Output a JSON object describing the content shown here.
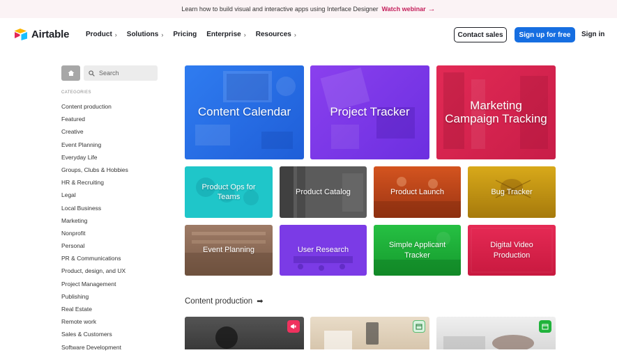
{
  "banner": {
    "text": "Learn how to build visual and interactive apps using Interface Designer",
    "link": "Watch webinar"
  },
  "nav": {
    "logo": "Airtable",
    "menu": [
      {
        "label": "Product",
        "chevron": true
      },
      {
        "label": "Solutions",
        "chevron": true
      },
      {
        "label": "Pricing",
        "chevron": false
      },
      {
        "label": "Enterprise",
        "chevron": true
      },
      {
        "label": "Resources",
        "chevron": true
      }
    ],
    "contact_sales": "Contact sales",
    "sign_up": "Sign up for free",
    "sign_in": "Sign in"
  },
  "sidebar": {
    "search_placeholder": "Search",
    "categories_title": "CATEGORIES",
    "categories": [
      "Content production",
      "Featured",
      "Creative",
      "Event Planning",
      "Everyday Life",
      "Groups, Clubs & Hobbies",
      "HR & Recruiting",
      "Legal",
      "Local Business",
      "Marketing",
      "Nonprofit",
      "Personal",
      "PR & Communications",
      "Product, design, and UX",
      "Project Management",
      "Publishing",
      "Real Estate",
      "Remote work",
      "Sales & Customers",
      "Software Development"
    ]
  },
  "featured": [
    {
      "label": "Content Calendar",
      "color": "#2467e0"
    },
    {
      "label": "Project Tracker",
      "color": "#7b37e8"
    },
    {
      "label": "Marketing Campaign Tracking",
      "color": "#d8214f"
    }
  ],
  "templates": [
    {
      "label": "Product Ops for Teams",
      "color": "#1fc6c9"
    },
    {
      "label": "Product Catalog",
      "color": "#5a5a5a"
    },
    {
      "label": "Product Launch",
      "color": "#c24718"
    },
    {
      "label": "Bug Tracker",
      "color": "#c79a12"
    },
    {
      "label": "Event Planning",
      "color": "#8c6a57"
    },
    {
      "label": "User Research",
      "color": "#7b3be6"
    },
    {
      "label": "Simple Applicant Tracker",
      "color": "#1fb53a"
    },
    {
      "label": "Digital Video Production",
      "color": "#e0234f"
    }
  ],
  "section": {
    "title": "Content production"
  },
  "colors": {
    "accent": "#166ee1",
    "banner_link": "#c41f5b"
  }
}
